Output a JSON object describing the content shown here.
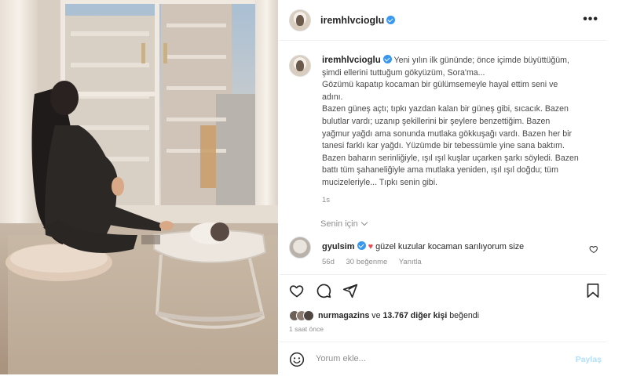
{
  "post": {
    "author": "iremhlvcioglu",
    "more_label": "•••",
    "caption": {
      "username": "iremhlvcioglu",
      "lines": [
        "Yeni yılın ilk gününde; önce içimde büyüttüğüm,",
        "şimdi ellerini tuttuğum gökyüzüm, Sora'ma...",
        "Gözümü kapatıp kocaman bir gülümsemeyle hayal ettim seni ve",
        "adını.",
        "Bazen güneş açtı; tıpkı yazdan kalan bir güneş gibi, sıcacık. Bazen",
        "bulutlar vardı; uzanıp şekillerini bir şeylere benzettiğim. Bazen",
        "yağmur yağdı ama sonunda mutlaka gökkuşağı vardı. Bazen her bir",
        "tanesi farklı kar yağdı. Yüzümde bir tebessümle yine sana baktım.",
        "Bazen baharın serinliğiyle, ışıl ışıl kuşlar uçarken şarkı söyledi. Bazen",
        "battı tüm şahaneliğiyle ama mutlaka yeniden, ışıl ışıl doğdu; tüm",
        "mucizeleriyle... Tıpkı senin gibi."
      ],
      "time": "1s"
    },
    "senin_icin": "Senin için",
    "comment": {
      "username": "gyulsim",
      "text": "güzel kuzular kocaman sarılıyorum size",
      "age": "56d",
      "likes": "30 beğenme",
      "reply": "Yanıtla"
    },
    "likes": {
      "user": "nurmagazins",
      "connector": "ve",
      "count_text": "13.767 diğer kişi",
      "suffix": "beğendi"
    },
    "posted_ago": "1 saat önce",
    "composer": {
      "placeholder": "Yorum ekle...",
      "post_label": "Paylaş"
    },
    "colors": {
      "verified": "#3897f0",
      "heart": "#ed4956",
      "post_button": "#b2dffc"
    },
    "icons": [
      "verified-icon",
      "more-icon",
      "heart-icon",
      "comment-icon",
      "share-icon",
      "bookmark-icon",
      "emoji-icon",
      "chevron-down-icon"
    ]
  }
}
